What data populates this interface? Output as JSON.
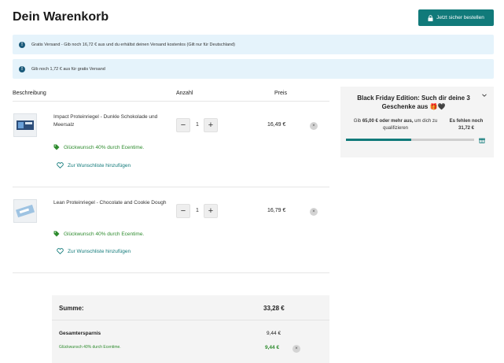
{
  "page": {
    "title": "Dein Warenkorb",
    "checkout_label": "Jetzt sicher bestellen"
  },
  "banners": [
    {
      "text": "Gratis Versand - Gib noch 16,72 € aus und du erhältst deinen Versand kostenlos (Gilt nur für Deutschland)"
    },
    {
      "text": "Gib noch 1,72 € aus für gratis Versand"
    }
  ],
  "table": {
    "col_desc": "Beschreibung",
    "col_qty": "Anzahl",
    "col_price": "Preis"
  },
  "items": [
    {
      "name": "Impact Proteinriegel - Dunkle Schokolade und Meersalz",
      "qty": "1",
      "minus": "−",
      "plus": "+",
      "price": "16,49 €",
      "promo": "Glückwunsch 40% durch Ecentime.",
      "wishlist": "Zur Wunschliste hinzufügen",
      "remove": "×"
    },
    {
      "name": "Lean Proteinriegel - Chocolate and Cookie Dough",
      "qty": "1",
      "minus": "−",
      "plus": "+",
      "price": "16,79 €",
      "promo": "Glückwunsch 40% durch Ecentime.",
      "wishlist": "Zur Wunschliste hinzufügen",
      "remove": "×"
    }
  ],
  "summary": {
    "total_label": "Summe:",
    "total": "33,28 €",
    "savings_label": "Gesamtersparnis",
    "savings": "9,44 €",
    "promo_label": "Glückwunsch 40% durch Ecentime.",
    "promo_value": "9,44 €",
    "remove": "×"
  },
  "black_friday": {
    "title": "Black Friday Edition: Such dir deine 3 Geschenke aus 🎁🖤",
    "left_pre": "Gib ",
    "left_bold": "65,00 € oder mehr aus,",
    "left_post": " um dich zu qualifizieren",
    "right_label": "Es fehlen noch",
    "right_value": "31,72 €",
    "progress": 0.512
  },
  "colors": {
    "accent": "#117a7a",
    "banner": "#e5f3fb",
    "promo": "#2e8b2e"
  },
  "icons": {
    "checkout": "lock-icon",
    "banner": "info-icon",
    "promo": "tag-icon",
    "wishlist": "heart-icon",
    "panel": "chevron-down-icon",
    "progress": "gift-icon"
  }
}
